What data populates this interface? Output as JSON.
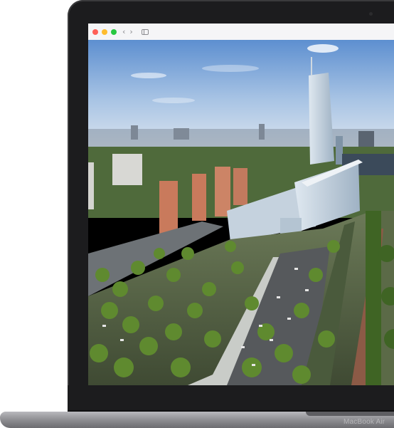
{
  "device": {
    "model_label": "MacBook Air"
  },
  "browser": {
    "traffic_lights": {
      "close": "#ff5f57",
      "minimize": "#febc2e",
      "maximize": "#28c840"
    },
    "back_glyph": "‹",
    "forward_glyph": "›",
    "sidebar_icon": "sidebar-icon"
  },
  "content": {
    "image": "aerial-architectural-rendering"
  }
}
